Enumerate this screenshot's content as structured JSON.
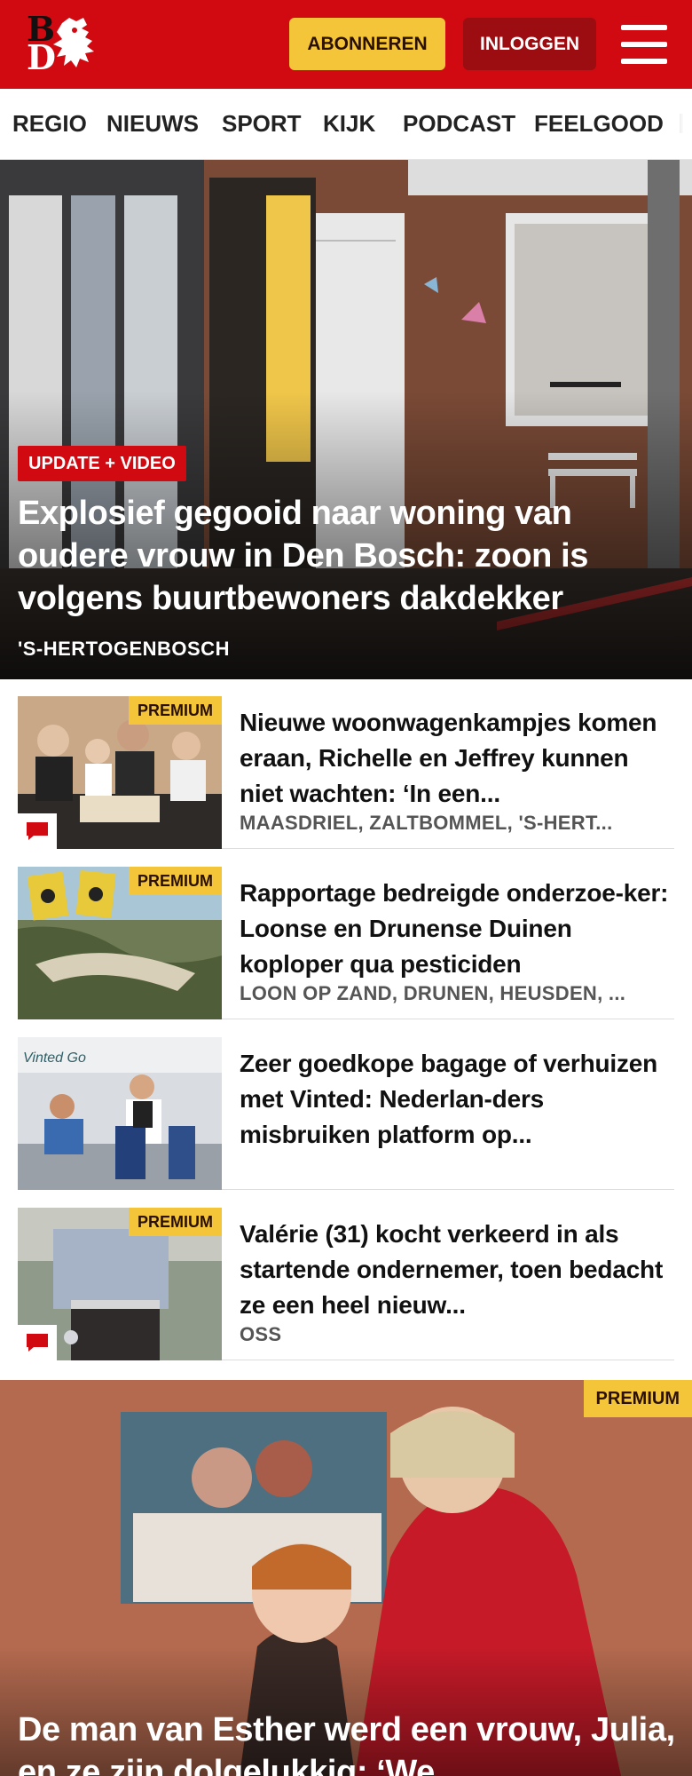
{
  "header": {
    "logo_letters": [
      "B",
      "D"
    ],
    "subscribe_label": "ABONNEREN",
    "login_label": "INLOGGEN",
    "brand_color": "#d10a11",
    "accent_color": "#f5c539"
  },
  "nav": {
    "items": [
      "REGIO",
      "NIEUWS",
      "SPORT",
      "KIJK",
      "PODCAST",
      "FEELGOOD"
    ]
  },
  "hero": {
    "tag": "UPDATE + VIDEO",
    "title": "Explosief gegooid naar woning van oudere vrouw in Den Bosch: zoon is volgens buurtbewoners dakdekker",
    "location": "'S-HERTOGENBOSCH"
  },
  "articles": [
    {
      "premium": "PREMIUM",
      "title": "Nieuwe woonwagenkampjes komen eraan, Richelle en Jeffrey kunnen niet wachten: ‘In een...",
      "location": "MAASDRIEL, ZALTBOMMEL, 'S-HERT...",
      "has_comments": true
    },
    {
      "premium": "PREMIUM",
      "title": "Rapportage bedreigde onderzoe-ker: Loonse en Drunense Duinen koploper qua pesticiden",
      "location": "LOON OP ZAND, DRUNEN, HEUSDEN, ...",
      "has_comments": false
    },
    {
      "premium": "",
      "title": "Zeer goedkope bagage of verhuizen met Vinted: Nederlan-ders misbruiken platform op...",
      "location": "",
      "has_comments": false,
      "thumb_text": "Vinted Go"
    },
    {
      "premium": "PREMIUM",
      "title": "Valérie (31) kocht verkeerd in als startende ondernemer, toen bedacht ze een heel nieuw...",
      "location": "OSS",
      "has_comments": true
    }
  ],
  "feature": {
    "premium": "PREMIUM",
    "title": "De man van Esther werd een vrouw, Julia, en ze zijn dolgelukkig: ‘We..."
  },
  "icons": {
    "menu": "hamburger-icon",
    "comment": "comment-icon",
    "logo_animal": "lion-icon"
  }
}
